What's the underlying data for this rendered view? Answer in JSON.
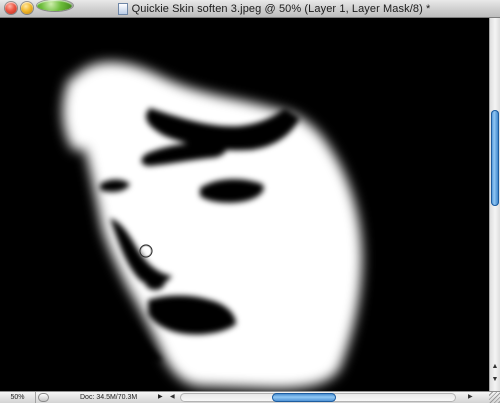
{
  "window": {
    "title": "Quickie Skin soften 3.jpeg @ 50% (Layer 1, Layer Mask/8) *"
  },
  "status_bar": {
    "zoom": "50%",
    "doc_info": "Doc: 34.5M/70.3M"
  },
  "scroll": {
    "vertical_position": 0.25,
    "horizontal_position": 0.5
  },
  "colors": {
    "mask_black": "#000000",
    "mask_white": "#ffffff",
    "scroll_accent": "#3f86cf"
  },
  "icons": {
    "close": "close-button",
    "minimize": "minimize-button",
    "zoom": "zoom-button",
    "document": "document-icon",
    "brush_cursor": "brush-cursor-icon"
  }
}
